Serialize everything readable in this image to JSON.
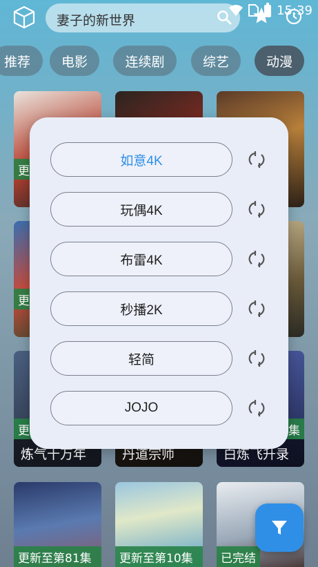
{
  "status": {
    "time": "15:39"
  },
  "search": {
    "text": "妻子的新世界"
  },
  "categories": [
    {
      "label": "推荐"
    },
    {
      "label": "电影"
    },
    {
      "label": "连续剧"
    },
    {
      "label": "综艺"
    },
    {
      "label": "动漫",
      "selected": true
    }
  ],
  "cards": [
    {
      "badge": "更",
      "title": ""
    },
    {
      "badge": "",
      "title": ""
    },
    {
      "badge": "",
      "title": ""
    },
    {
      "badge": "更",
      "title": ""
    },
    {
      "badge": "",
      "title": ""
    },
    {
      "badge": "",
      "title": ""
    },
    {
      "badge": "更",
      "title": "炼气十万年"
    },
    {
      "badge": "",
      "title": "丹道宗师"
    },
    {
      "badge": "集",
      "title": "白炼飞升录"
    },
    {
      "badge": "更新至第81集",
      "title": ""
    },
    {
      "badge": "更新至第10集",
      "title": ""
    },
    {
      "badge": "已完结",
      "title": ""
    }
  ],
  "sources": [
    {
      "label": "如意4K",
      "active": true
    },
    {
      "label": "玩偶4K"
    },
    {
      "label": "布雷4K"
    },
    {
      "label": "秒播2K"
    },
    {
      "label": "轻简"
    },
    {
      "label": "JOJO"
    }
  ],
  "colors": {
    "accent": "#2f8fe6",
    "badge": "#288246"
  }
}
